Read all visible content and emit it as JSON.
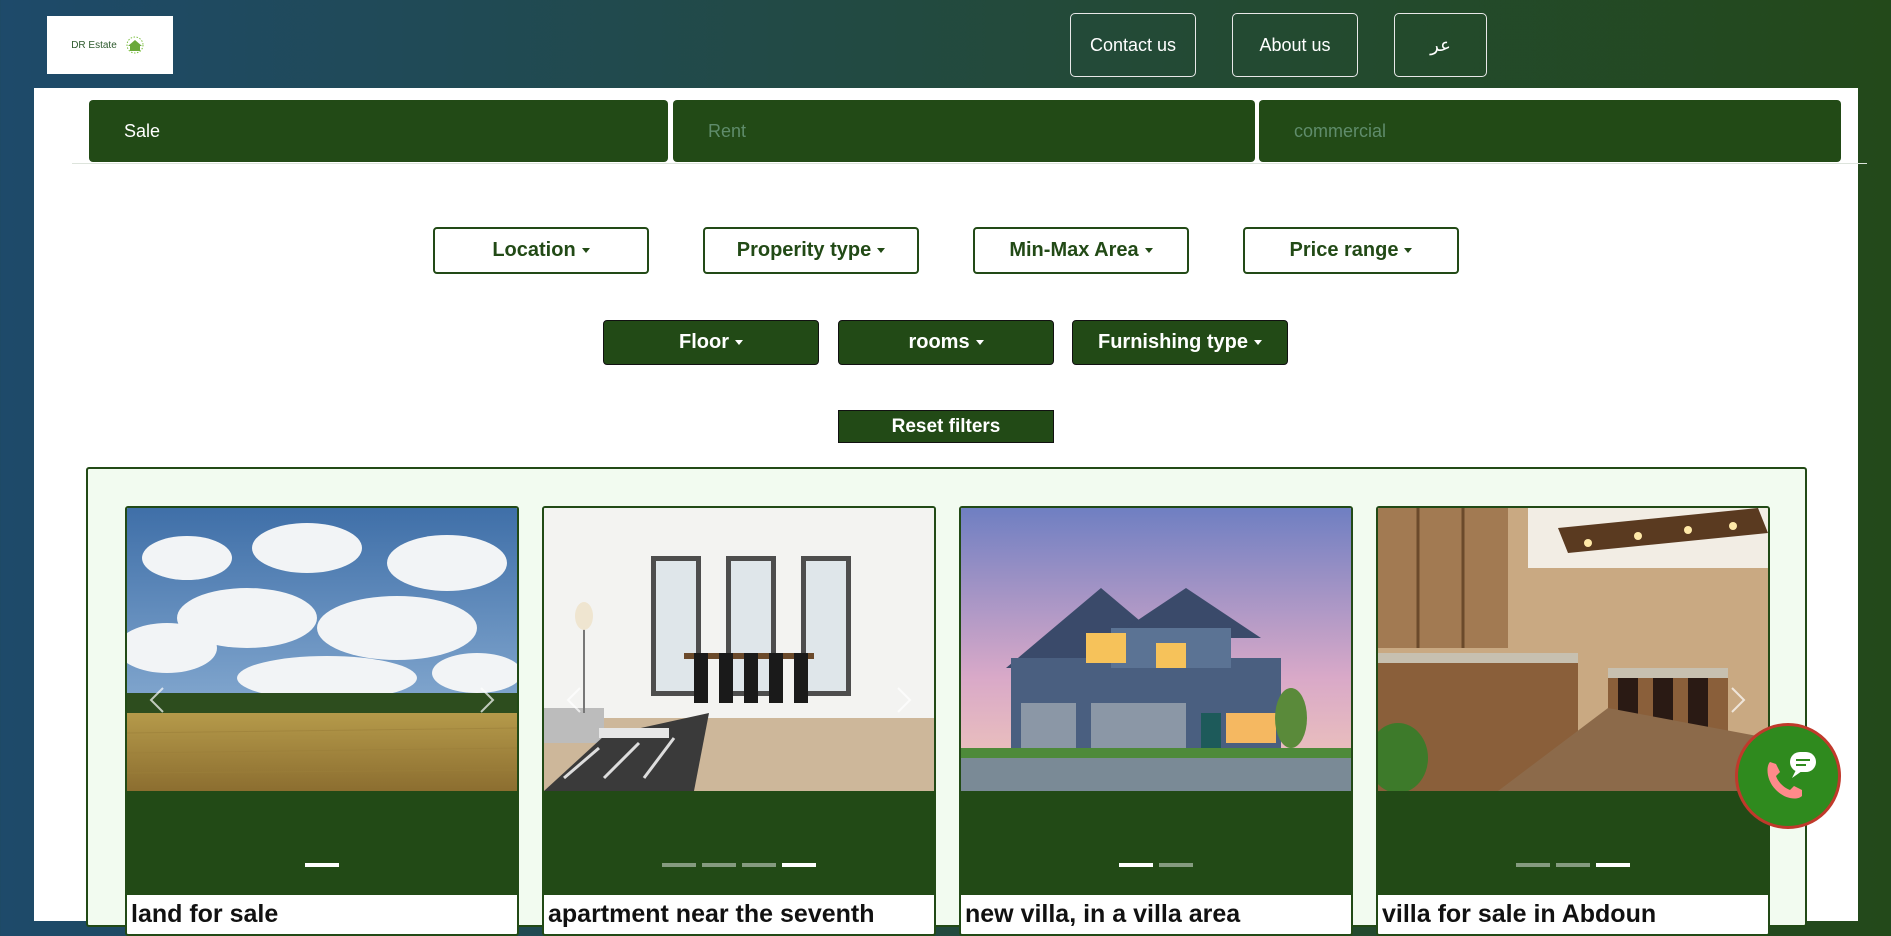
{
  "header": {
    "logo_text": "DR Estate",
    "nav": [
      {
        "label": "Contact us"
      },
      {
        "label": "About us"
      },
      {
        "label": "عر"
      }
    ]
  },
  "tabs": [
    {
      "label": "Sale",
      "active": true
    },
    {
      "label": "Rent",
      "active": false
    },
    {
      "label": "commercial",
      "active": false
    }
  ],
  "filters": {
    "row1": [
      "Location",
      "Properity type",
      "Min-Max Area",
      "Price range"
    ],
    "row2": [
      "Floor",
      "rooms",
      "Furnishing type"
    ],
    "reset_label": "Reset filters"
  },
  "listings": [
    {
      "title": "land for sale",
      "image": "field-landscape",
      "slides": 1,
      "active_slide": 1
    },
    {
      "title": "apartment near the seventh",
      "image": "dining-room-interior",
      "slides": 4,
      "active_slide": 4
    },
    {
      "title": "new villa, in a villa area",
      "image": "house-exterior",
      "slides": 2,
      "active_slide": 1
    },
    {
      "title": "villa for sale in Abdoun",
      "image": "kitchen-interior",
      "slides": 3,
      "active_slide": 3
    }
  ],
  "colors": {
    "brand_green": "#224a16",
    "inactive_tab_text": "#5f8c6b",
    "call_button": "#2f8a1e",
    "call_border": "#c0392b"
  }
}
